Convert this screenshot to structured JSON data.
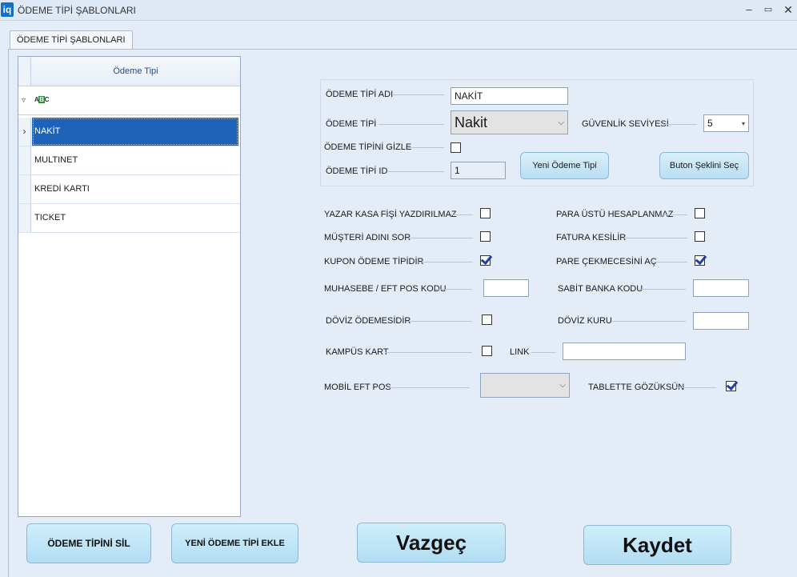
{
  "window": {
    "logo": "iq",
    "title": "ÖDEME TİPİ ŞABLONLARI",
    "min": "–",
    "max": "▭",
    "close": "✕"
  },
  "tab": {
    "label": "ÖDEME TİPİ ŞABLONLARI"
  },
  "grid": {
    "column_header": "Ödeme Tipi",
    "filter_abc": "ABC",
    "rows": [
      {
        "label": "NAKİT",
        "selected": true
      },
      {
        "label": "MULTINET",
        "selected": false
      },
      {
        "label": "KREDİ KARTI",
        "selected": false
      },
      {
        "label": "TICKET",
        "selected": false
      }
    ],
    "row_indicator": "›"
  },
  "form": {
    "name_label": "ÖDEME TİPİ ADI",
    "name_value": "NAKİT",
    "type_label": "ÖDEME TİPİ",
    "type_value": "Nakit",
    "security_label": "GÜVENLİK SEVİYESİ",
    "security_value": "5",
    "hide_label": "ÖDEME TİPİNİ GİZLE",
    "hide_checked": false,
    "id_label": "ÖDEME TİPİ ID",
    "id_value": "1",
    "new_type_button": "Yeni Ödeme Tipi",
    "button_shape_button": "Buton Şeklini Seç"
  },
  "options": {
    "cash_receipt_label": "YAZAR KASA FİŞİ YAZDIRILMAZ",
    "cash_receipt_checked": false,
    "change_label": "PARA ÜSTÜ HESAPLANMAZ",
    "change_checked": false,
    "ask_customer_label": "MÜŞTERİ ADINI SOR",
    "ask_customer_checked": false,
    "invoice_label": "FATURA KESİLİR",
    "invoice_checked": false,
    "coupon_label": "KUPON ÖDEME TİPİDİR",
    "coupon_checked": true,
    "drawer_label": "PARE ÇEKMECESİNİ AÇ",
    "drawer_checked": true,
    "accounting_label": "MUHASEBE / EFT POS KODU",
    "accounting_value": "",
    "bank_label": "SABİT BANKA KODU",
    "bank_value": "",
    "currency_label": "DÖVİZ ÖDEMESİDİR",
    "currency_checked": false,
    "rate_label": "DÖVİZ KURU",
    "rate_value": "",
    "campus_label": "KAMPÜS KART",
    "campus_checked": false,
    "link_label": "LINK",
    "link_value": "",
    "mobile_label": "MOBİL EFT POS",
    "mobile_value": "",
    "tablet_label": "TABLETTE GÖZÜKSÜN",
    "tablet_checked": true
  },
  "actions": {
    "delete": "ÖDEME TİPİNİ SİL",
    "add": "YENİ ÖDEME TİPİ EKLE",
    "cancel": "Vazgeç",
    "save": "Kaydet"
  },
  "icons": {
    "filter": "filter-icon",
    "dropdown": "chevron-down-icon",
    "dropdown_small": "caret-down-icon"
  }
}
